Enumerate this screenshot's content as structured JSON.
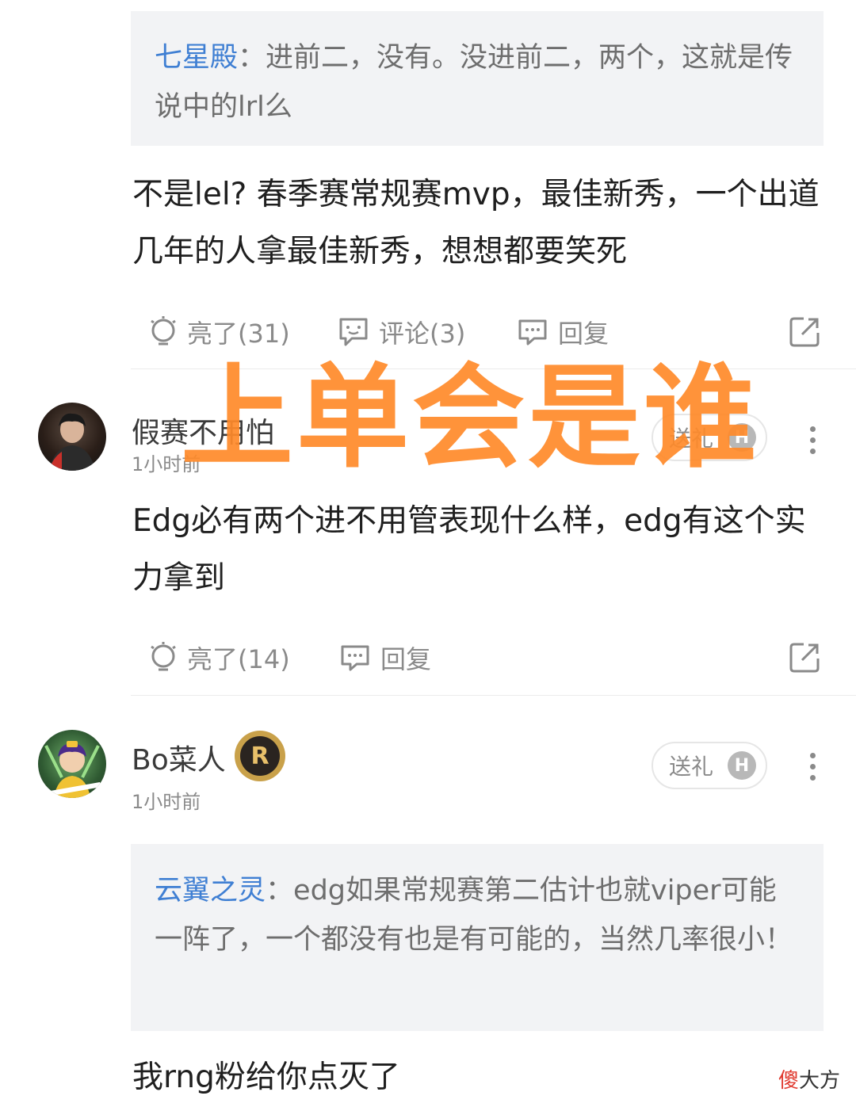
{
  "comment1": {
    "quote": {
      "name": "七星殿",
      "sep": "：",
      "text": "进前二，没有。没进前二，两个，这就是传说中的lrl么"
    },
    "content": "不是lel? 春季赛常规赛mvp，最佳新秀，一个出道几年的人拿最佳新秀，想想都要笑死",
    "like_label": "亮了(31)",
    "comment_label": "评论(3)",
    "reply_label": "回复"
  },
  "comment2": {
    "username": "假赛不用怕",
    "time": "1小时前",
    "gift_label": "送礼",
    "content": "Edg必有两个进不用管表现什么样，edg有这个实力拿到",
    "like_label": "亮了(14)",
    "reply_label": "回复"
  },
  "comment3": {
    "username": "Bo菜人",
    "badge_text": "R",
    "time": "1小时前",
    "gift_label": "送礼",
    "quote": {
      "name": "云翼之灵",
      "sep": "：",
      "text": "edg如果常规赛第二估计也就viper可能一阵了，一个都没有也是有可能的，当然几率很小！"
    },
    "content": "我rng粉给你点灭了"
  },
  "overlay_text": "上单会是谁",
  "watermark": {
    "part1": "傻",
    "part2": "大方"
  },
  "colors": {
    "quote_name": "#3f7fd3",
    "overlay": "#ff8a2a",
    "quote_bg": "#f2f3f5"
  }
}
